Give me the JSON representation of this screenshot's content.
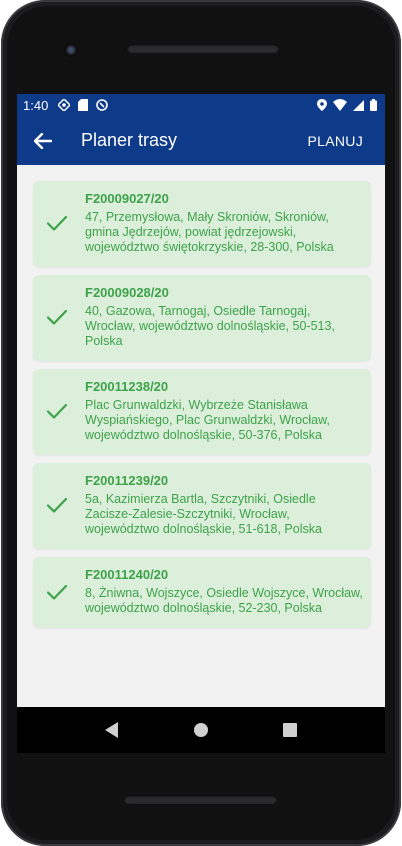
{
  "status_bar": {
    "time": "1:40"
  },
  "app_bar": {
    "title": "Planer trasy",
    "action_label": "PLANUJ"
  },
  "colors": {
    "primary": "#0e3a8a",
    "card_bg": "#dcefdb",
    "card_text": "#3ea24a"
  },
  "icons": {
    "back": "arrow-back-icon",
    "check": "check-icon"
  },
  "orders": [
    {
      "id": "F20009027/20",
      "address": "47, Przemysłowa, Mały Skroniów, Skroniów, gmina Jędrzejów, powiat jędrzejowski, województwo świętokrzyskie, 28-300, Polska"
    },
    {
      "id": "F20009028/20",
      "address": "40, Gazowa, Tarnogaj, Osiedle Tarnogaj, Wrocław, województwo dolnośląskie, 50-513, Polska"
    },
    {
      "id": "F20011238/20",
      "address": "Plac Grunwaldzki, Wybrzeże Stanisława Wyspiańskiego, Plac Grunwaldzki, Wrocław, województwo dolnośląskie, 50-376, Polska"
    },
    {
      "id": "F20011239/20",
      "address": "5a, Kazimierza Bartla, Szczytniki, Osiedle Zacisze-Zalesie-Szczytniki, Wrocław, województwo dolnośląskie, 51-618, Polska"
    },
    {
      "id": "F20011240/20",
      "address": "8, Żniwna, Wojszyce, Osiedle Wojszyce, Wrocław, województwo dolnośląskie, 52-230, Polska"
    }
  ]
}
